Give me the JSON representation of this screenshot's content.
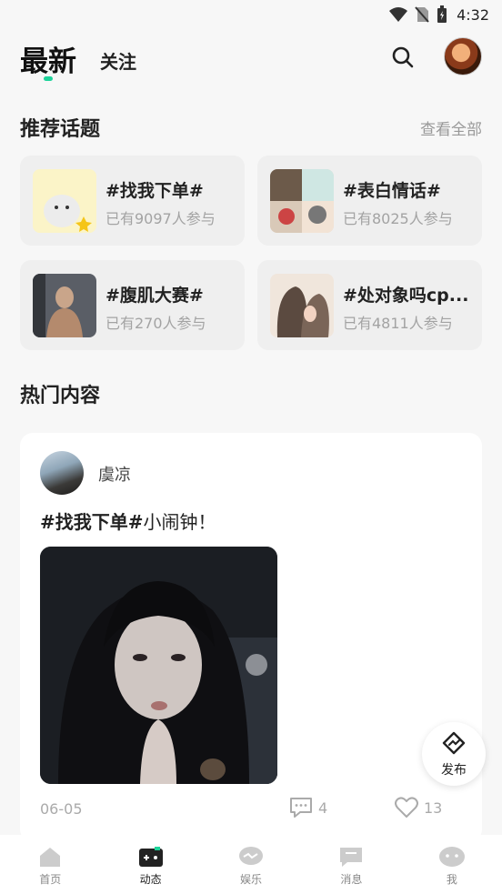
{
  "status_bar": {
    "time": "4:32"
  },
  "header": {
    "tab_latest": "最新",
    "tab_follow": "关注",
    "accent": "#1ed39a"
  },
  "recommended": {
    "title": "推荐话题",
    "see_all": "查看全部",
    "topics": [
      {
        "name": "#找我下单#",
        "count": "已有9097人参与"
      },
      {
        "name": "#表白情话#",
        "count": "已有8025人参与"
      },
      {
        "name": "#腹肌大赛#",
        "count": "已有270人参与"
      },
      {
        "name": "#处对象吗cp...",
        "count": "已有4811人参与"
      }
    ]
  },
  "hot": {
    "title": "热门内容",
    "post": {
      "username": "虞凉",
      "hashtag": "#找我下单#",
      "text": "小闹钟！",
      "date": "06-05",
      "comments": "4",
      "likes": "13"
    }
  },
  "fab": {
    "label": "发布"
  },
  "bottom_nav": [
    {
      "label": "首页",
      "icon": "home-icon"
    },
    {
      "label": "动态",
      "icon": "gamepad-icon"
    },
    {
      "label": "娱乐",
      "icon": "chat-bubble-icon"
    },
    {
      "label": "消息",
      "icon": "message-icon"
    },
    {
      "label": "我",
      "icon": "face-icon"
    }
  ]
}
